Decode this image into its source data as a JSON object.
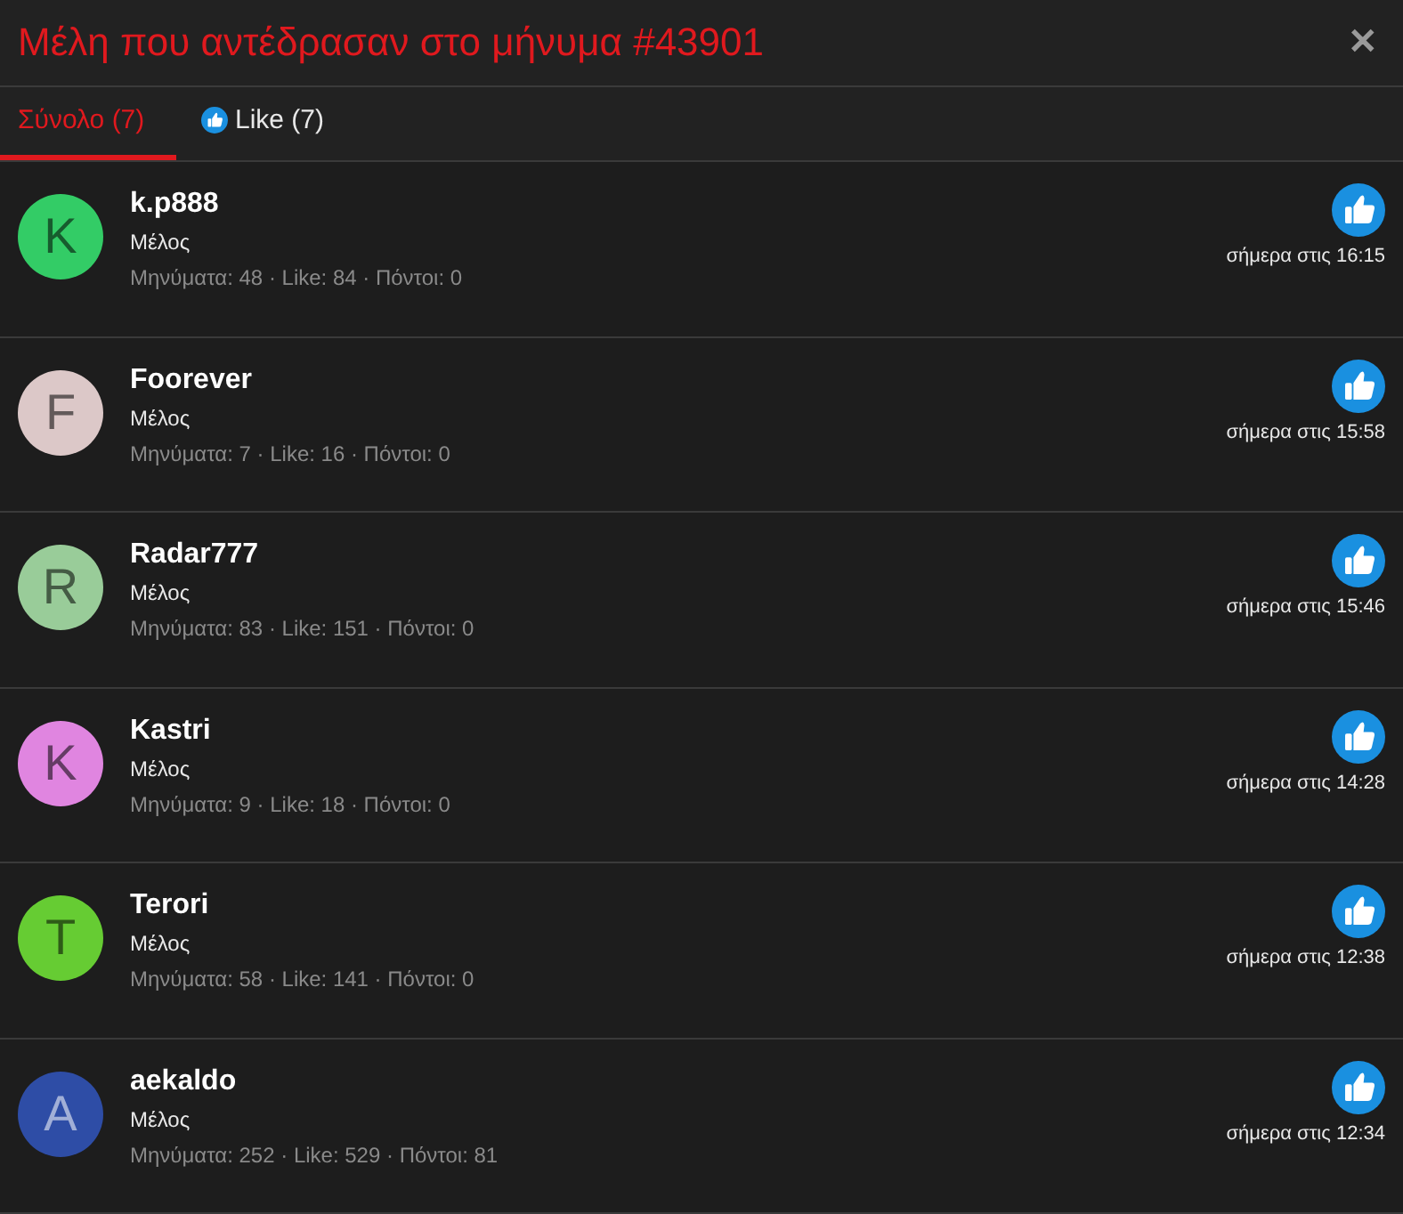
{
  "title": "Μέλη που αντέδρασαν στο μήνυμα #43901",
  "close": "✕",
  "tabs": [
    {
      "label": "Σύνολο (7)",
      "selected": true,
      "kind": "all"
    },
    {
      "label": "Like (7)",
      "selected": false,
      "kind": "like"
    }
  ],
  "members": [
    {
      "initial": "K",
      "color": "#33cc66",
      "name": "k.p888",
      "role": "Μέλος",
      "stats": "Μηνύματα: 48 · Like: 84 · Πόντοι: 0",
      "time": "σήμερα στις 16:15"
    },
    {
      "initial": "F",
      "color": "#dcc8c8",
      "name": "Foorever",
      "role": "Μέλος",
      "stats": "Μηνύματα: 7 · Like: 16 · Πόντοι: 0",
      "time": "σήμερα στις 15:58"
    },
    {
      "initial": "R",
      "color": "#99cc99",
      "name": "Radar777",
      "role": "Μέλος",
      "stats": "Μηνύματα: 83 · Like: 151 · Πόντοι: 0",
      "time": "σήμερα στις 15:46"
    },
    {
      "initial": "K",
      "color": "#e085e0",
      "name": "Kastri",
      "role": "Μέλος",
      "stats": "Μηνύματα: 9 · Like: 18 · Πόντοι: 0",
      "time": "σήμερα στις 14:28"
    },
    {
      "initial": "T",
      "color": "#66cc33",
      "name": "Terori",
      "role": "Μέλος",
      "stats": "Μηνύματα: 58 · Like: 141 · Πόντοι: 0",
      "time": "σήμερα στις 12:38"
    },
    {
      "initial": "A",
      "color": "#2e4da6",
      "name": "aekaldo",
      "role": "Μέλος",
      "stats": "Μηνύματα: 252 · Like: 529 · Πόντοι: 81",
      "time": "σήμερα στις 12:34"
    }
  ]
}
